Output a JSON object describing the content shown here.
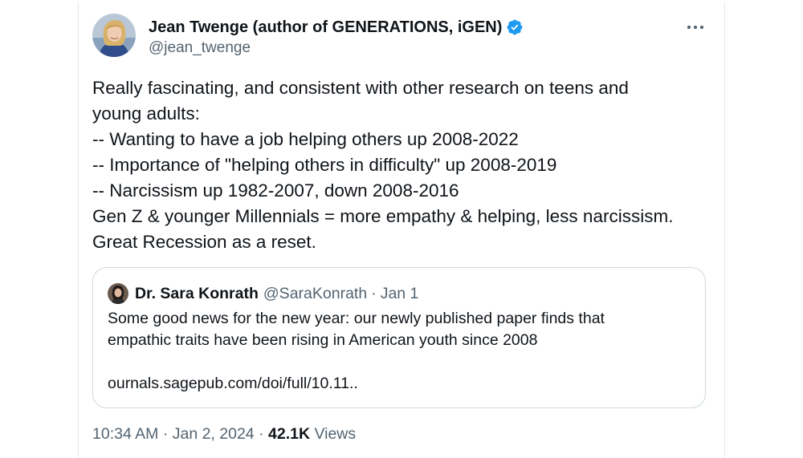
{
  "author": {
    "display_name": "Jean Twenge (author of GENERATIONS, iGEN)",
    "handle": "@jean_twenge",
    "verified": true,
    "verified_color": "#1d9bf0"
  },
  "tweet": {
    "lines": [
      "Really fascinating, and consistent with other research on teens and",
      "young adults:",
      "-- Wanting to have a job helping others up 2008-2022",
      "-- Importance of \"helping others in difficulty\" up 2008-2019",
      "-- Narcissism up 1982-2007, down 2008-2016",
      "Gen Z & younger Millennials = more empathy & helping, less narcissism.",
      "Great Recession as a reset."
    ]
  },
  "quoted_tweet": {
    "display_name": "Dr. Sara Konrath",
    "handle": "@SaraKonrath",
    "separator": "·",
    "date": "Jan 1",
    "lines": [
      "Some good news for the new year: our newly published paper finds that",
      "empathic traits have been rising in American youth since 2008"
    ],
    "link": "ournals.sagepub.com/doi/full/10.11.."
  },
  "meta": {
    "time": "10:34 AM",
    "separator1": "·",
    "date": "Jan 2, 2024",
    "separator2": "·",
    "views_count": "42.1K",
    "views_label": "Views"
  },
  "icons": {
    "more": "more-horizontal-icon",
    "verified": "verified-badge-icon"
  }
}
